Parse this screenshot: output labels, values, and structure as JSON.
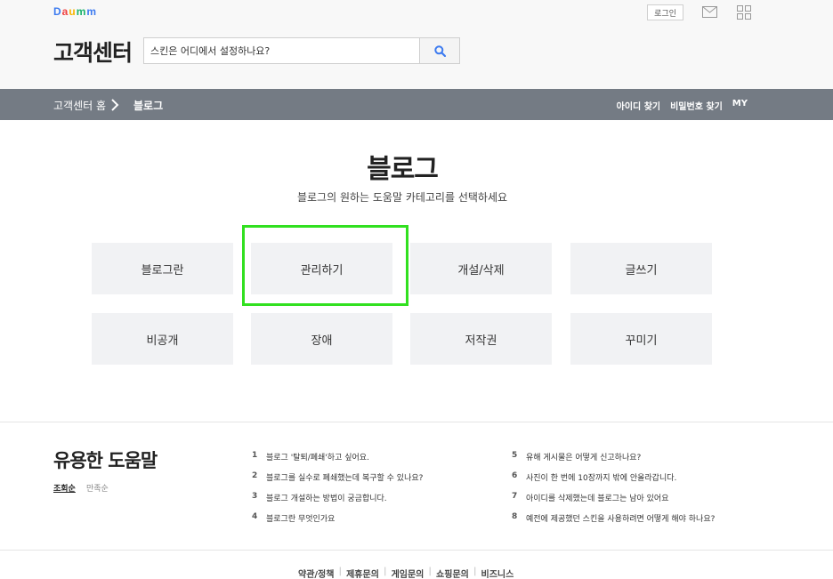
{
  "header": {
    "logo_letters": [
      "D",
      "a",
      "u",
      "m",
      "m"
    ],
    "login_label": "로그인",
    "title": "고객센터",
    "search_placeholder": "스킨은 어디에서 설정하나요?"
  },
  "nav": {
    "home": "고객센터 홈",
    "current": "블로그",
    "links": [
      "아이디 찾기",
      "비밀번호 찾기",
      "MY"
    ]
  },
  "main": {
    "title": "블로그",
    "subtitle": "블로그의 원하는 도움말 카테고리를 선택하세요",
    "categories": [
      "블로그란",
      "관리하기",
      "개설/삭제",
      "글쓰기",
      "비공개",
      "장애",
      "저작권",
      "꾸미기"
    ]
  },
  "help": {
    "title": "유용한 도움말",
    "sort_options": [
      "조회순",
      "만족순"
    ],
    "items": [
      {
        "num": "1",
        "text": "블로그 '탈퇴/폐쇄'하고 싶어요."
      },
      {
        "num": "2",
        "text": "블로그를 실수로 폐쇄했는데 복구할 수 있나요?"
      },
      {
        "num": "3",
        "text": "블로그 개설하는 방법이 궁금합니다."
      },
      {
        "num": "4",
        "text": "블로그란 무엇인가요"
      },
      {
        "num": "5",
        "text": "유해 게시물은 어떻게 신고하나요?"
      },
      {
        "num": "6",
        "text": "사진이 한 번에 10장까지 밖에 안올라갑니다."
      },
      {
        "num": "7",
        "text": "아이디를 삭제했는데 블로그는 남아 있어요"
      },
      {
        "num": "8",
        "text": "예전에 제공했던 스킨을 사용하려면 어떻게 해야 하나요?"
      }
    ]
  },
  "footer": {
    "links": [
      "약관/정책",
      "제휴문의",
      "게임문의",
      "쇼핑문의",
      "비즈니스"
    ]
  },
  "colors": {
    "navbar": "#747b84",
    "highlight": "#31e01f",
    "search_icon": "#3d7bf0"
  }
}
